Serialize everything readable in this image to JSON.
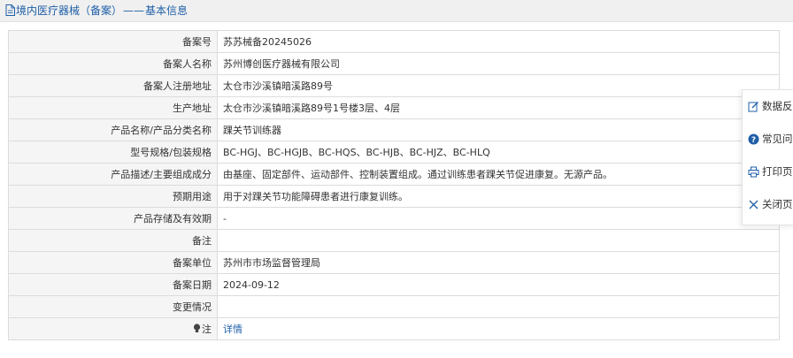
{
  "breadcrumb": {
    "section": "境内医疗器械（备案）",
    "separator": "——",
    "page": "基本信息"
  },
  "rows": [
    {
      "label": "备案号",
      "value": "苏苏械备20245026"
    },
    {
      "label": "备案人名称",
      "value": "苏州博创医疗器械有限公司"
    },
    {
      "label": "备案人注册地址",
      "value": "太仓市沙溪镇暗溪路89号"
    },
    {
      "label": "生产地址",
      "value": "太仓市沙溪镇暗溪路89号1号楼3层、4层"
    },
    {
      "label": "产品名称/产品分类名称",
      "value": "踝关节训练器"
    },
    {
      "label": "型号规格/包装规格",
      "value": "BC-HGJ、BC-HGJB、BC-HQS、BC-HJB、BC-HJZ、BC-HLQ"
    },
    {
      "label": "产品描述/主要组成成分",
      "value": "由基座、固定部件、运动部件、控制装置组成。通过训练患者踝关节促进康复。无源产品。"
    },
    {
      "label": "预期用途",
      "value": "用于对踝关节功能障碍患者进行康复训练。"
    },
    {
      "label": "产品存储及有效期",
      "value": "-"
    },
    {
      "label": "备注",
      "value": ""
    },
    {
      "label": "备案单位",
      "value": "苏州市市场监督管理局"
    },
    {
      "label": "备案日期",
      "value": "2024-09-12"
    },
    {
      "label": "变更情况",
      "value": ""
    }
  ],
  "note_row": {
    "label": "注",
    "link_text": "详情",
    "icon": "lightbulb-icon"
  },
  "float_menu": {
    "feedback": "数据反",
    "faq": "常见问",
    "print": "打印页",
    "close": "关闭页"
  },
  "colors": {
    "link": "#1f5fa8",
    "header_bg": "#f0f0f0",
    "label_bg": "#f5f5f5",
    "border": "#dcdcdc"
  }
}
